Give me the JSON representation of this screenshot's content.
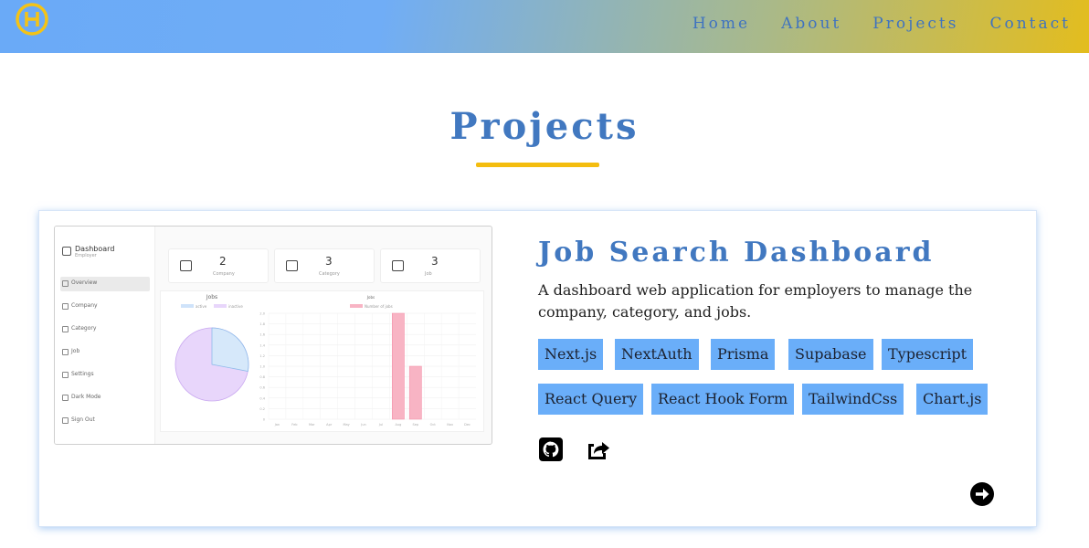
{
  "nav": {
    "logo_icon": "logo-h-icon",
    "items": [
      {
        "label": "Home"
      },
      {
        "label": "About"
      },
      {
        "label": "Projects"
      },
      {
        "label": "Contact"
      }
    ]
  },
  "section": {
    "title": "Projects"
  },
  "project": {
    "title": "Job Search Dashboard",
    "description": "A dashboard web application for employers to manage the company, category, and jobs.",
    "tags": [
      "Next.js",
      "NextAuth",
      "Prisma",
      "Supabase",
      "Typescript",
      "React Query",
      "React Hook Form",
      "TailwindCss",
      "Chart.js"
    ],
    "links": [
      {
        "icon": "github-icon"
      },
      {
        "icon": "external-share-icon"
      }
    ],
    "next_icon": "arrow-right-circle-icon"
  },
  "screenshot": {
    "brand": "Dashboard",
    "brand_sub": "Employer",
    "menu": [
      "Overview",
      "Company",
      "Category",
      "Job",
      "Settings",
      "Dark Mode",
      "Sign Out"
    ],
    "stats": [
      {
        "value": "2",
        "label": "Company"
      },
      {
        "value": "3",
        "label": "Category"
      },
      {
        "value": "3",
        "label": "Job"
      }
    ],
    "pie_title": "Jobs",
    "pie_legend": [
      "active",
      "inactive"
    ],
    "bar_title": "Jobs",
    "bar_legend": "Number of jobs",
    "months": [
      "Jan",
      "Feb",
      "Mar",
      "Apr",
      "May",
      "Jun",
      "Jul",
      "Aug",
      "Sep",
      "Oct",
      "Nov",
      "Dec"
    ],
    "yticks": [
      "2.0",
      "1.8",
      "1.6",
      "1.4",
      "1.2",
      "1.0",
      "0.8",
      "0.6",
      "0.4",
      "0.2",
      "0"
    ],
    "bar_values": [
      0,
      0,
      0,
      0,
      0,
      0,
      0,
      2,
      1,
      0,
      0,
      0
    ]
  },
  "colors": {
    "accent": "#4178c0",
    "underline": "#f4bd0f",
    "tag_bg": "#6aaef9"
  }
}
